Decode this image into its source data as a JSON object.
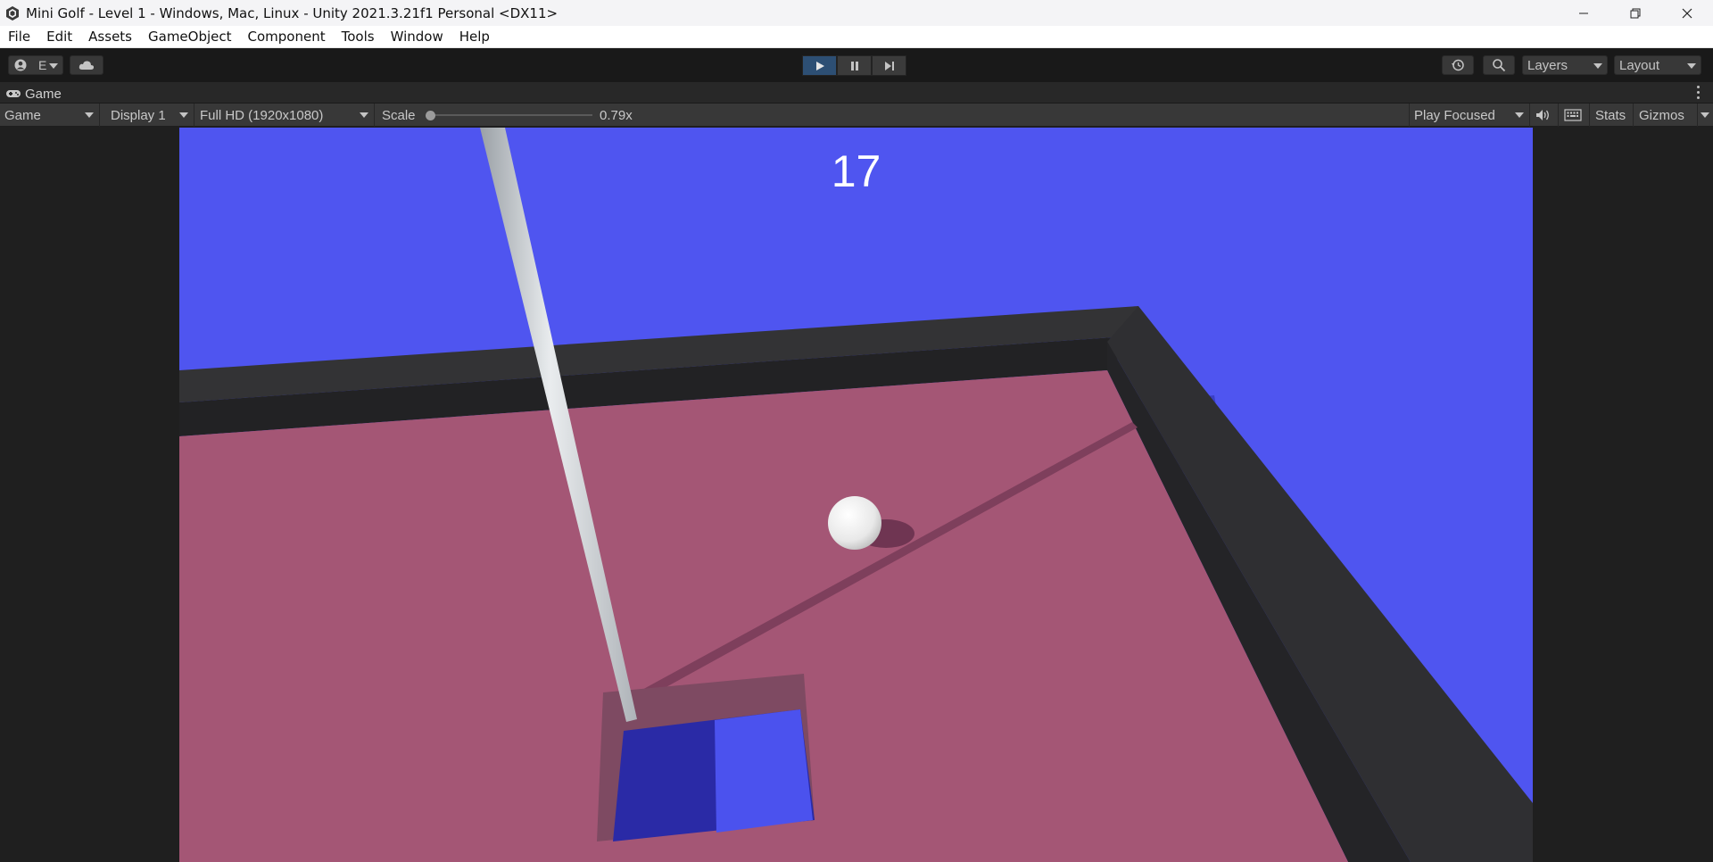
{
  "window": {
    "title": "Mini Golf - Level 1 - Windows, Mac, Linux - Unity 2021.3.21f1 Personal <DX11>"
  },
  "menu": [
    "File",
    "Edit",
    "Assets",
    "GameObject",
    "Component",
    "Tools",
    "Window",
    "Help"
  ],
  "toolbar": {
    "account_label": "E",
    "layers_label": "Layers",
    "layout_label": "Layout",
    "play_state": "playing"
  },
  "tab": {
    "label": "Game"
  },
  "game_toolbar": {
    "view_mode": "Game",
    "display": "Display 1",
    "resolution": "Full HD (1920x1080)",
    "scale_label": "Scale",
    "scale_value": "0.79x",
    "scale_fraction": 0.0,
    "play_mode": "Play Focused",
    "stats_label": "Stats",
    "gizmos_label": "Gizmos"
  },
  "game": {
    "score": "17"
  },
  "colors": {
    "sky": "#4f55f0",
    "green": "#a45675",
    "wall": "#2d2d30",
    "ball": "#f2f2f2",
    "accent_play": "#2d4f74"
  }
}
